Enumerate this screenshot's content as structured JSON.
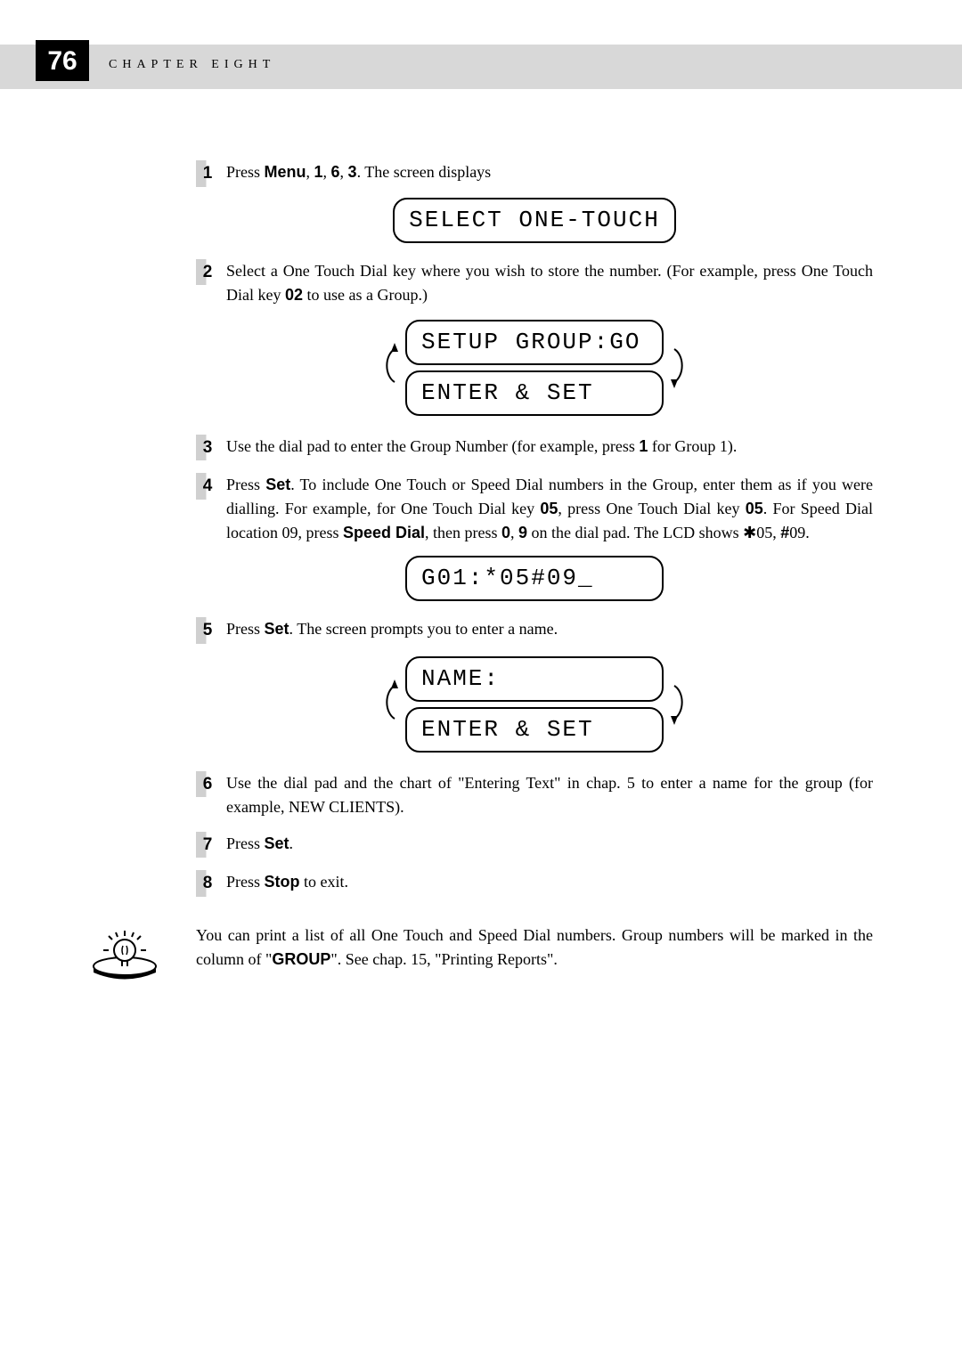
{
  "page_number": "76",
  "chapter_title": "CHAPTER EIGHT",
  "steps": {
    "s1": {
      "num": "1",
      "t1": "Press ",
      "t2": "Menu",
      "t3": ", ",
      "t4": "1",
      "t5": ", ",
      "t6": "6",
      "t7": ", ",
      "t8": "3",
      "t9": ". The screen displays"
    },
    "s2": {
      "num": "2",
      "t1": "Select a One Touch Dial key where you wish to store the number. (For example, press One Touch Dial key ",
      "t2": "02",
      "t3": " to use as a Group.)"
    },
    "s3": {
      "num": "3",
      "t1": "Use the dial pad to enter the Group Number (for example, press ",
      "t2": "1",
      "t3": " for Group 1)."
    },
    "s4": {
      "num": "4",
      "t1": "Press ",
      "t2": "Set",
      "t3": ". To include One Touch or Speed Dial numbers in the Group, enter them as if you were dialling. For example, for One Touch Dial key ",
      "t4": "05",
      "t5": ", press One Touch Dial key ",
      "t6": "05",
      "t7": ". For Speed Dial location 09, press ",
      "t8": "Speed Dial",
      "t9": ", then press ",
      "t10": "0",
      "t11": ", ",
      "t12": "9",
      "t13": " on the dial pad. The LCD shows ",
      "t14": "✱",
      "t15": "05, ",
      "t16": "#",
      "t17": "09."
    },
    "s5": {
      "num": "5",
      "t1": "Press ",
      "t2": "Set",
      "t3": ".  The screen prompts you to enter a name."
    },
    "s6": {
      "num": "6",
      "t1": "Use the dial pad and the chart of \"Entering Text\" in chap. 5 to enter a name for the group (for example, NEW CLIENTS)."
    },
    "s7": {
      "num": "7",
      "t1": "Press ",
      "t2": "Set",
      "t3": "."
    },
    "s8": {
      "num": "8",
      "t1": "Press ",
      "t2": "Stop",
      "t3": " to exit."
    }
  },
  "lcd": {
    "l1": "SELECT ONE-TOUCH",
    "l2a": "SETUP GROUP:GO",
    "l2b": "ENTER & SET",
    "l3": "G01:*05#09_",
    "l4a": "NAME:",
    "l4b": "ENTER & SET"
  },
  "note": {
    "t1": "You can print a list of all One Touch and Speed Dial numbers. Group numbers will be marked in the column of \"",
    "t2": "GROUP",
    "t3": "\". See chap. 15, \"Printing Reports\"."
  }
}
